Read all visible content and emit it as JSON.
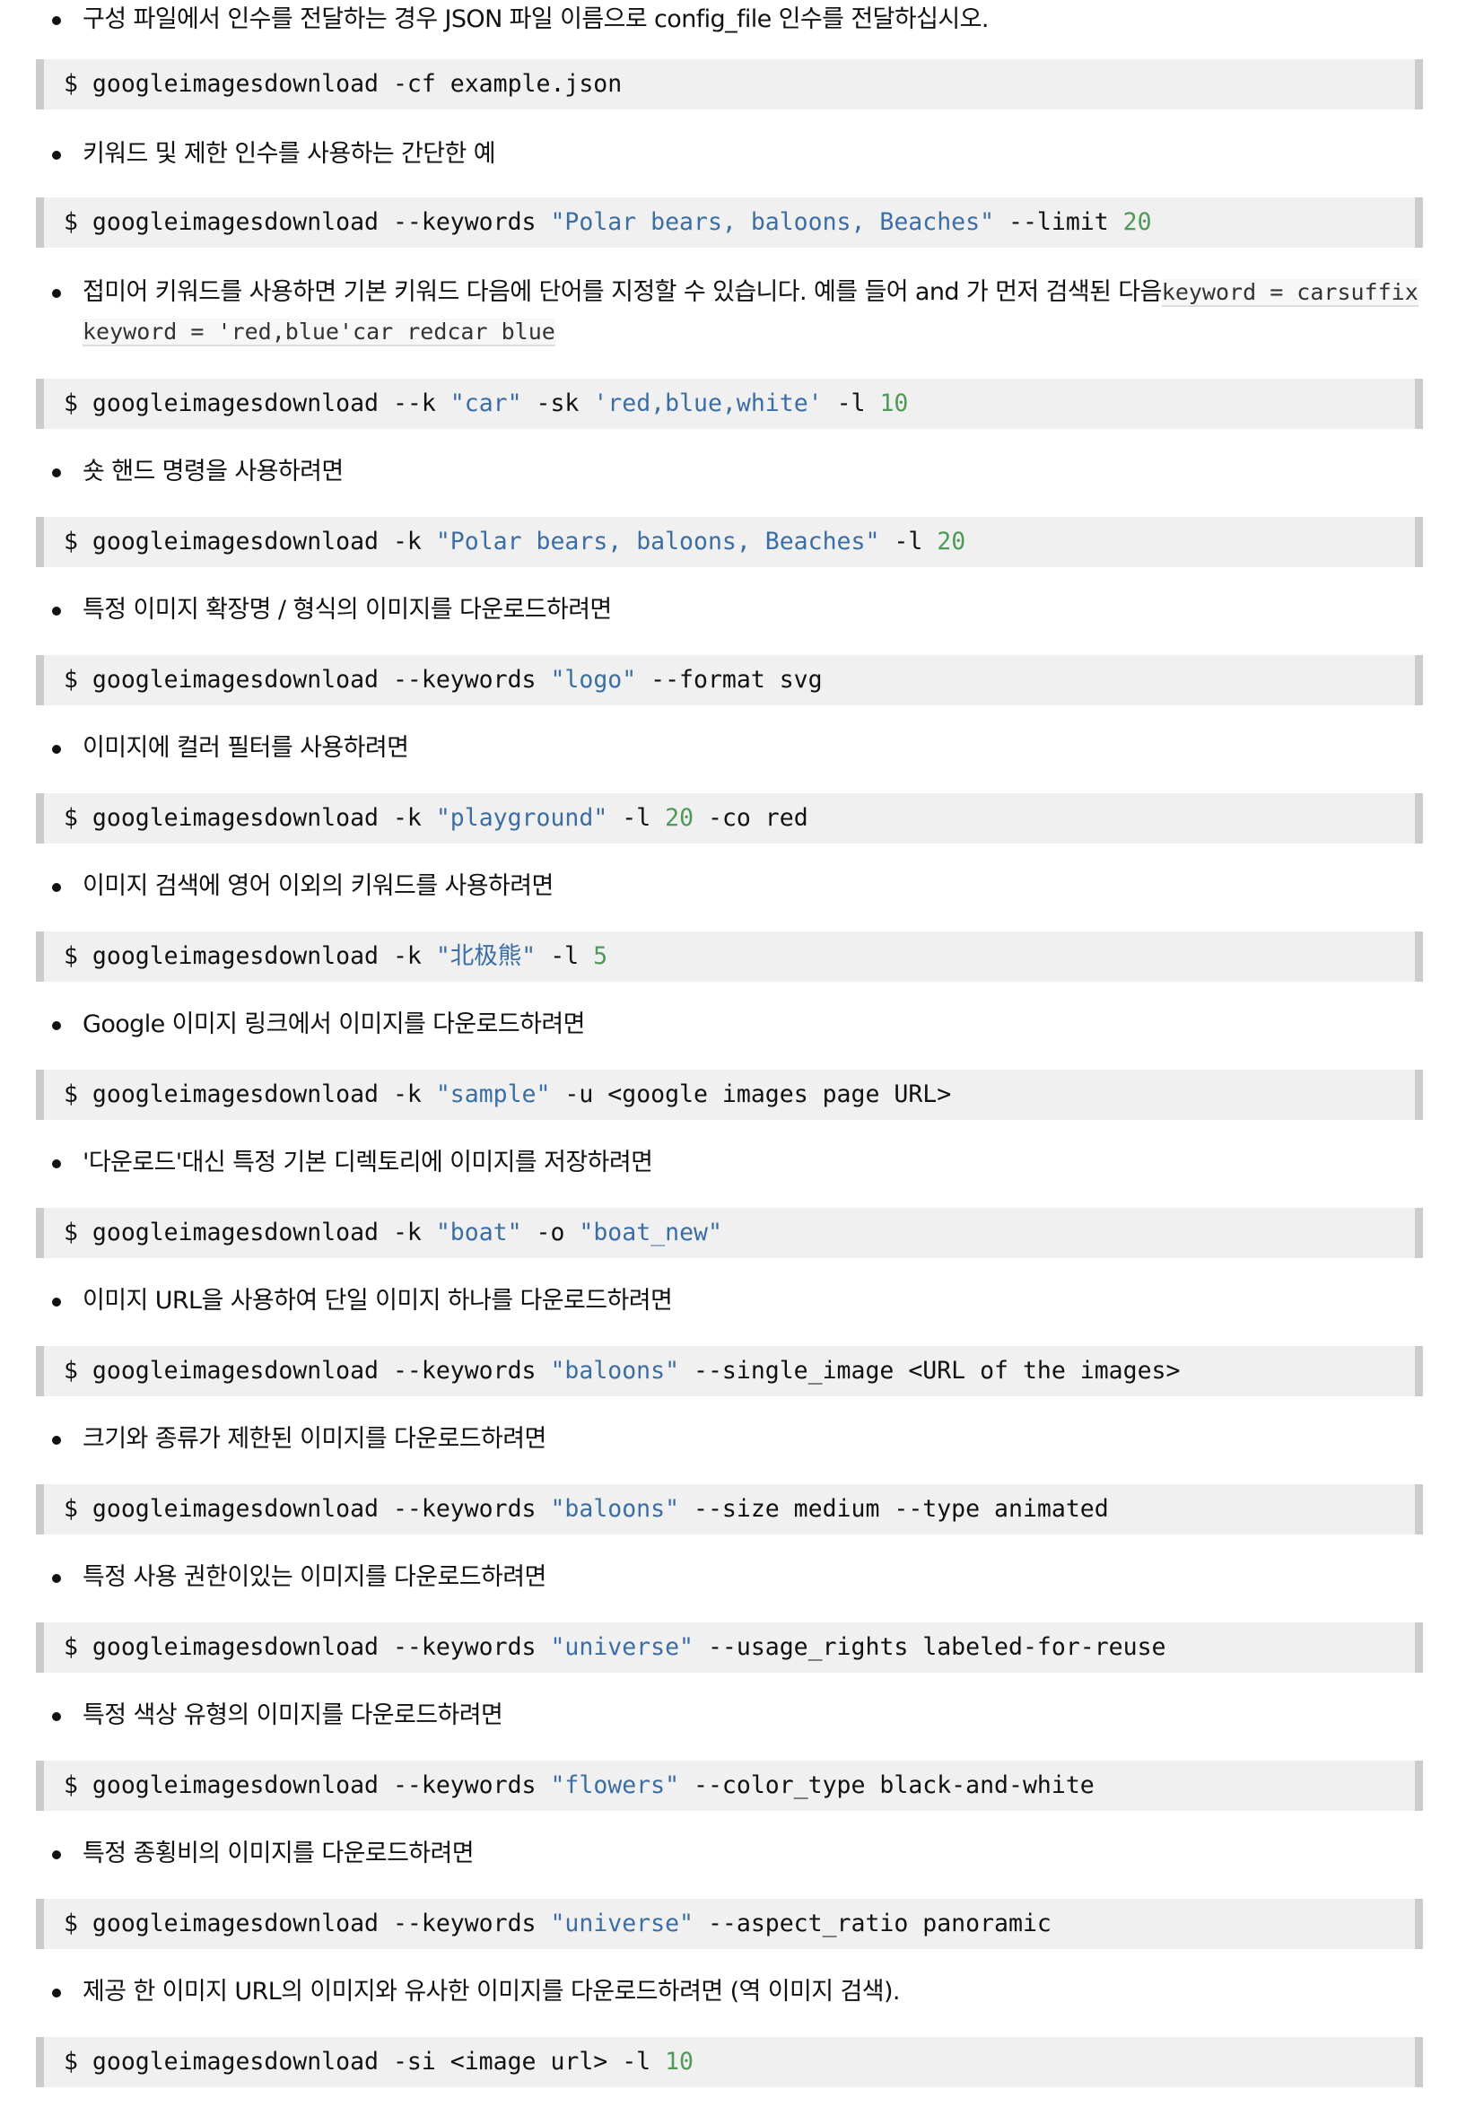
{
  "items": [
    {
      "type": "bullet",
      "text": "구성 파일에서 인수를 전달하는 경우 JSON 파일 이름으로 config_file 인수를 전달하십시오."
    },
    {
      "type": "code",
      "tokens": [
        {
          "t": "$ googleimagesdownload -cf example.json",
          "k": "plain"
        }
      ]
    },
    {
      "type": "bullet",
      "text": "키워드 및 제한 인수를 사용하는 간단한 예"
    },
    {
      "type": "code",
      "tokens": [
        {
          "t": "$ googleimagesdownload --keywords ",
          "k": "plain"
        },
        {
          "t": "\"Polar bears, baloons, Beaches\"",
          "k": "str"
        },
        {
          "t": " --limit ",
          "k": "plain"
        },
        {
          "t": "20",
          "k": "num"
        }
      ]
    },
    {
      "type": "bullet-inline",
      "text": "접미어 키워드를 사용하면 기본 키워드 다음에 단어를 지정할 수 있습니다. 예를 들어 and 가 먼저 검색된 다음",
      "code1": "keyword = carsuffix",
      "code2": "keyword = 'red,blue'car redcar blue"
    },
    {
      "type": "code",
      "tokens": [
        {
          "t": "$ googleimagesdownload --k ",
          "k": "plain"
        },
        {
          "t": "\"car\"",
          "k": "str"
        },
        {
          "t": " -sk ",
          "k": "plain"
        },
        {
          "t": "'red,blue,white'",
          "k": "str"
        },
        {
          "t": " -l ",
          "k": "plain"
        },
        {
          "t": "10",
          "k": "num"
        }
      ]
    },
    {
      "type": "bullet",
      "text": "숏 핸드 명령을 사용하려면"
    },
    {
      "type": "code",
      "tokens": [
        {
          "t": "$ googleimagesdownload -k ",
          "k": "plain"
        },
        {
          "t": "\"Polar bears, baloons, Beaches\"",
          "k": "str"
        },
        {
          "t": " -l ",
          "k": "plain"
        },
        {
          "t": "20",
          "k": "num"
        }
      ]
    },
    {
      "type": "bullet",
      "text": "특정 이미지 확장명 / 형식의 이미지를 다운로드하려면"
    },
    {
      "type": "code",
      "tokens": [
        {
          "t": "$ googleimagesdownload --keywords ",
          "k": "plain"
        },
        {
          "t": "\"logo\"",
          "k": "str"
        },
        {
          "t": " --format svg",
          "k": "plain"
        }
      ]
    },
    {
      "type": "bullet",
      "text": "이미지에 컬러 필터를 사용하려면"
    },
    {
      "type": "code",
      "tokens": [
        {
          "t": "$ googleimagesdownload -k ",
          "k": "plain"
        },
        {
          "t": "\"playground\"",
          "k": "str"
        },
        {
          "t": " -l ",
          "k": "plain"
        },
        {
          "t": "20",
          "k": "num"
        },
        {
          "t": " -co red",
          "k": "plain"
        }
      ]
    },
    {
      "type": "bullet",
      "text": "이미지 검색에 영어 이외의 키워드를 사용하려면"
    },
    {
      "type": "code",
      "tokens": [
        {
          "t": "$ googleimagesdownload -k ",
          "k": "plain"
        },
        {
          "t": "\"北极熊\"",
          "k": "str"
        },
        {
          "t": " -l ",
          "k": "plain"
        },
        {
          "t": "5",
          "k": "num"
        }
      ]
    },
    {
      "type": "bullet",
      "text": "Google 이미지 링크에서 이미지를 다운로드하려면"
    },
    {
      "type": "code",
      "tokens": [
        {
          "t": "$ googleimagesdownload -k ",
          "k": "plain"
        },
        {
          "t": "\"sample\"",
          "k": "str"
        },
        {
          "t": " -u <google images page URL>",
          "k": "plain"
        }
      ]
    },
    {
      "type": "bullet",
      "text": "'다운로드'대신 특정 기본 디렉토리에 이미지를 저장하려면"
    },
    {
      "type": "code",
      "tokens": [
        {
          "t": "$ googleimagesdownload -k ",
          "k": "plain"
        },
        {
          "t": "\"boat\"",
          "k": "str"
        },
        {
          "t": " -o ",
          "k": "plain"
        },
        {
          "t": "\"boat_new\"",
          "k": "str"
        }
      ]
    },
    {
      "type": "bullet",
      "text": "이미지 URL을 사용하여 단일 이미지 하나를 다운로드하려면"
    },
    {
      "type": "code",
      "tokens": [
        {
          "t": "$ googleimagesdownload --keywords ",
          "k": "plain"
        },
        {
          "t": "\"baloons\"",
          "k": "str"
        },
        {
          "t": " --single_image <URL of the images>",
          "k": "plain"
        }
      ]
    },
    {
      "type": "bullet",
      "text": "크기와 종류가 제한된 이미지를 다운로드하려면"
    },
    {
      "type": "code",
      "tokens": [
        {
          "t": "$ googleimagesdownload --keywords ",
          "k": "plain"
        },
        {
          "t": "\"baloons\"",
          "k": "str"
        },
        {
          "t": " --size medium --type animated",
          "k": "plain"
        }
      ]
    },
    {
      "type": "bullet",
      "text": "특정 사용 권한이있는 이미지를 다운로드하려면"
    },
    {
      "type": "code",
      "tokens": [
        {
          "t": "$ googleimagesdownload --keywords ",
          "k": "plain"
        },
        {
          "t": "\"universe\"",
          "k": "str"
        },
        {
          "t": " --usage_rights labeled-for-reuse",
          "k": "plain"
        }
      ]
    },
    {
      "type": "bullet",
      "text": "특정 색상 유형의 이미지를 다운로드하려면"
    },
    {
      "type": "code",
      "tokens": [
        {
          "t": "$ googleimagesdownload --keywords ",
          "k": "plain"
        },
        {
          "t": "\"flowers\"",
          "k": "str"
        },
        {
          "t": " --color_type black-and-white",
          "k": "plain"
        }
      ]
    },
    {
      "type": "bullet",
      "text": "특정 종횡비의 이미지를 다운로드하려면"
    },
    {
      "type": "code",
      "tokens": [
        {
          "t": "$ googleimagesdownload --keywords ",
          "k": "plain"
        },
        {
          "t": "\"universe\"",
          "k": "str"
        },
        {
          "t": " --aspect_ratio panoramic",
          "k": "plain"
        }
      ]
    },
    {
      "type": "bullet",
      "text": "제공 한 이미지 URL의 이미지와 유사한 이미지를 다운로드하려면 (역 이미지 검색)."
    },
    {
      "type": "code",
      "tokens": [
        {
          "t": "$ googleimagesdownload -si <image url> -l ",
          "k": "plain"
        },
        {
          "t": "10",
          "k": "num"
        }
      ]
    }
  ]
}
